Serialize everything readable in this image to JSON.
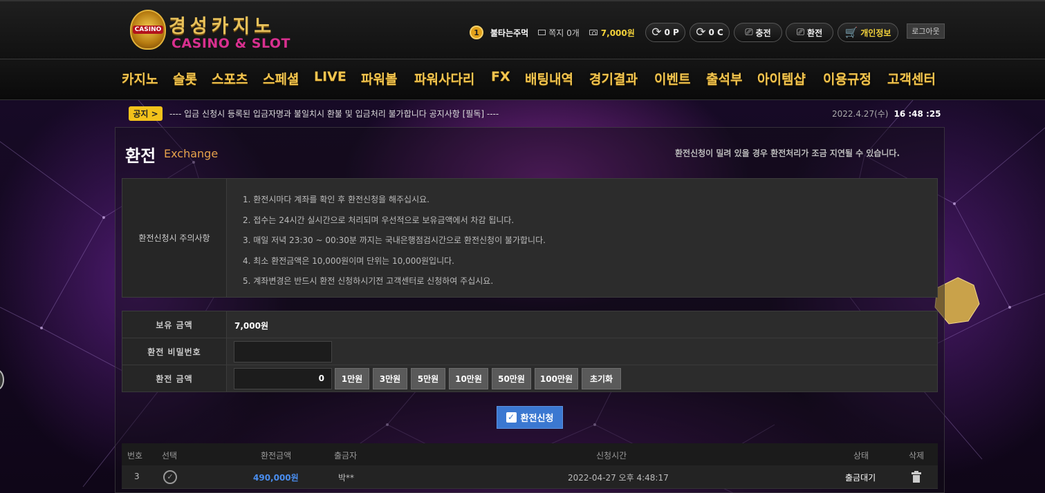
{
  "header": {
    "logo_kr": "경성카지노",
    "logo_en": "CASINO & SLOT",
    "emblem_text": "CASINO",
    "level": "1",
    "username": "불타는주먹",
    "messages": "쪽지 0개",
    "balance": "7,000원",
    "point_label": "0 P",
    "comp_label": "0 C",
    "deposit_label": "충전",
    "exchange_label": "환전",
    "profile_label": "개인정보",
    "logout_label": "로그아웃"
  },
  "nav": [
    "카지노",
    "슬롯",
    "스포츠",
    "스페셜",
    "LIVE",
    "파워볼",
    "파워사다리",
    "FX",
    "배팅내역",
    "경기결과",
    "이벤트",
    "출석부",
    "아이템샵",
    "이용규정",
    "고객센터"
  ],
  "notice": {
    "label": "공지 >",
    "text": "---- 입금 신청시 등록된 입금자명과 불일치시 환불 및 입금처리 불가합니다 공지사항 [필독] ----",
    "date": "2022.4.27(수)",
    "time": "16 :48 :25"
  },
  "page": {
    "title": "환전",
    "title_en": "Exchange",
    "delay_note": "환전신청이 밀려 있을 경우 환전처리가 조금 지연될 수 있습니다."
  },
  "caution": {
    "label": "환전신청시 주의사항",
    "items": [
      "1. 환전시마다 계좌를 확인 후 환전신청을 해주십시요.",
      "2. 접수는 24시간 실시간으로 처리되며 우선적으로 보유금액에서 차감 됩니다.",
      "3. 매일 저녁 23:30 ~ 00:30분 까지는 국내은행점검시간으로 환전신청이 불가합니다.",
      "4. 최소 환전금액은 10,000원이며 단위는 10,000원입니다.",
      "5. 계좌변경은 반드시 환전 신청하시기전 고객센터로 신청하여 주십시요."
    ]
  },
  "form": {
    "balance_label": "보유 금액",
    "balance_value": "7,000원",
    "password_label": "환전 비밀번호",
    "amount_label": "환전 금액",
    "amount_value": "0",
    "buttons": [
      "1만원",
      "3만원",
      "5만원",
      "10만원",
      "50만원",
      "100만원",
      "초기화"
    ],
    "submit_label": "환전신청"
  },
  "history": {
    "columns": [
      "번호",
      "선택",
      "환전금액",
      "출금자",
      "신청시간",
      "상태",
      "삭제"
    ],
    "rows": [
      {
        "no": "3",
        "amount": "490,000원",
        "name": "박**",
        "time": "2022-04-27 오후 4:48:17",
        "status": "출금대기"
      }
    ]
  },
  "colors": {
    "gold": "#f1c44f",
    "accent_blue": "#3b78d1",
    "amount_blue": "#4a8ef0",
    "notice_yellow": "#f3c21b"
  }
}
